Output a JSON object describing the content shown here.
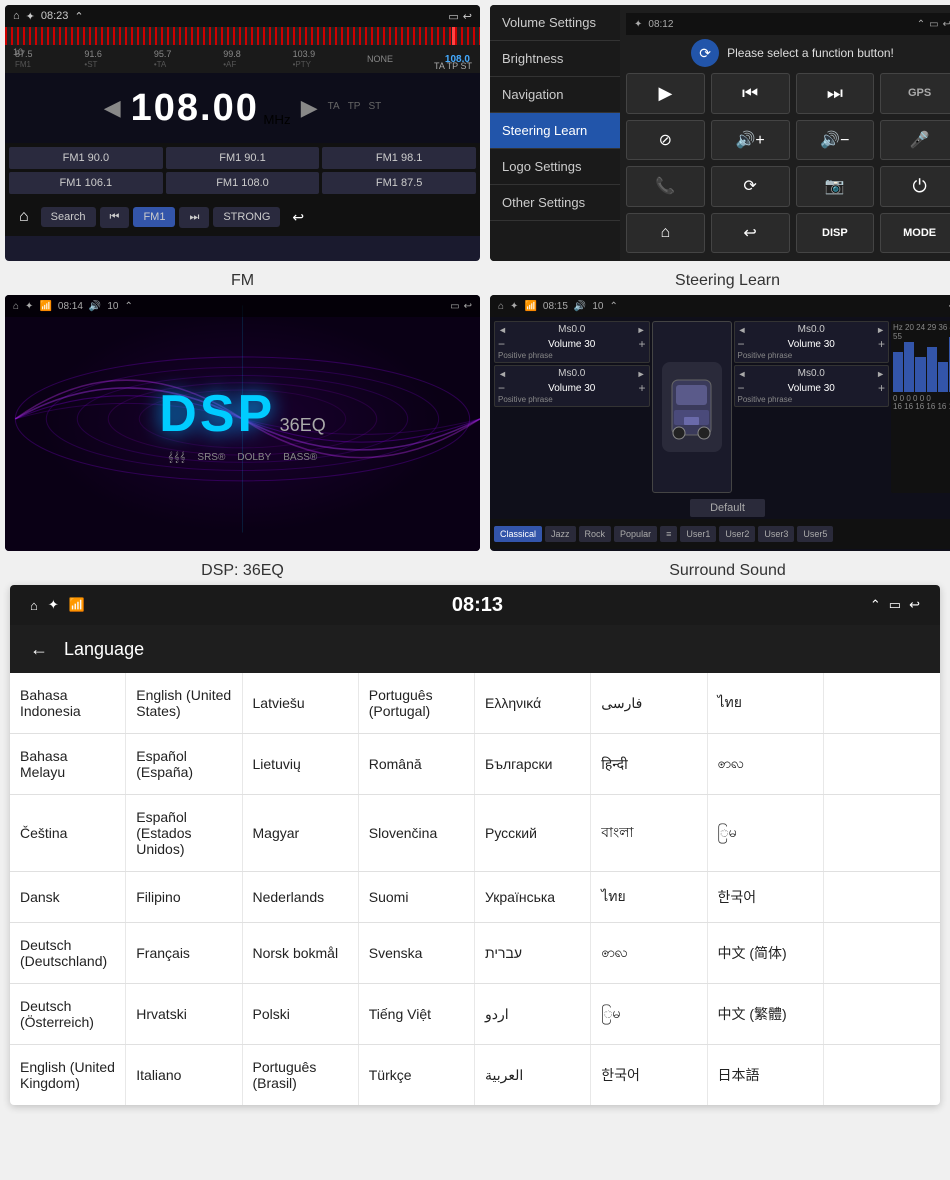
{
  "fm": {
    "caption": "FM",
    "status_bar": {
      "time": "08:23",
      "left_icons": [
        "home-icon",
        "bluetooth-icon",
        "signal-icon"
      ]
    },
    "frequency": "108.00",
    "unit": "MHz",
    "scale": {
      "values": [
        "87.5",
        "91.6",
        "95.7",
        "99.8",
        "103.9",
        "NONE",
        "108.0"
      ],
      "tags": [
        "FM1",
        "ST",
        "TA",
        "AF",
        "PTY",
        "",
        ""
      ],
      "bottom_tags": [
        "TA",
        "TP",
        "ST"
      ]
    },
    "presets": [
      "FM1 90.0",
      "FM1 90.1",
      "FM1 98.1",
      "FM1 106.1",
      "FM1 108.0",
      "FM1 87.5"
    ],
    "controls": [
      "🏠",
      "Search",
      "⏮",
      "FM1",
      "⏭",
      "STRONG",
      "↩"
    ]
  },
  "steering": {
    "caption": "Steering Learn",
    "status_bar_time": "08:12",
    "message": "Please select a function button!",
    "sidebar_items": [
      "Volume Settings",
      "Brightness",
      "Navigation",
      "Steering Learn",
      "Logo Settings",
      "Other Settings"
    ],
    "active_sidebar": "Steering Learn",
    "buttons": {
      "row1": [
        "▶",
        "⏮",
        "⏭",
        "GPS"
      ],
      "row2": [
        "⊘",
        "🔊+",
        "🔊-",
        "🎤"
      ],
      "row3": [
        "📞",
        "⟳",
        "📷",
        "⏻"
      ],
      "row4": [
        "🏠",
        "↩",
        "DISP",
        "MODE"
      ]
    },
    "gps_label": "GPS",
    "disp_label": "DISP",
    "mode_label": "MODE"
  },
  "dsp": {
    "caption": "DSP: 36EQ",
    "title": "DSP",
    "subtitle": "36EQ",
    "tags": [
      "𝄞𝄞𝄞",
      "SRS®",
      "DOLBY",
      "BASS®"
    ],
    "status_bar": {
      "time": "08:14",
      "volume": "10"
    }
  },
  "surround": {
    "caption": "Surround Sound",
    "status_bar": {
      "time": "08:15",
      "volume": "10"
    },
    "controls": [
      {
        "preset": "Ms0.0",
        "volume": "Volume 30",
        "phrase": "Positive phrase"
      },
      {
        "preset": "Ms0.0",
        "volume": "Volume 30",
        "phrase": "Positive phrase"
      },
      {
        "preset": "Ms0.0",
        "volume": "Volume 30",
        "phrase": "Positive phrase"
      },
      {
        "preset": "Ms0.0",
        "volume": "Volume 30",
        "phrase": "Positive phrase"
      }
    ],
    "default_btn": "Default",
    "tabs": [
      "Classical",
      "Jazz",
      "Rock",
      "Popular",
      "",
      "User1",
      "User2",
      "User3",
      "User5"
    ]
  },
  "language": {
    "status_bar": {
      "time": "08:13",
      "left": "⌂",
      "right_icons": [
        "signal-icon",
        "bluetooth-icon",
        "expand-icon",
        "window-icon",
        "back-icon"
      ]
    },
    "back_label": "←",
    "title": "Language",
    "rows": [
      [
        "Bahasa Indonesia",
        "English (United States)",
        "Latviešu",
        "Português (Portugal)",
        "Ελληνικά",
        "فارسی",
        "ไทย",
        ""
      ],
      [
        "Bahasa Melayu",
        "Español (España)",
        "Lietuvių",
        "Română",
        "Български",
        "हिन्दी",
        "ꩦꩮ",
        ""
      ],
      [
        "Čeština",
        "Español (Estados Unidos)",
        "Magyar",
        "Slovenčina",
        "Русский",
        "বাংলা",
        "ြမ",
        ""
      ],
      [
        "Dansk",
        "Filipino",
        "Nederlands",
        "Suomi",
        "Українська",
        "ไทย",
        "한국어",
        ""
      ],
      [
        "Deutsch (Deutschland)",
        "Français",
        "Norsk bokmål",
        "Svenska",
        "עברית",
        "ꩦꩮ",
        "中文 (简体)",
        ""
      ],
      [
        "Deutsch (Österreich)",
        "Hrvatski",
        "Polski",
        "Tiếng Việt",
        "اردو",
        "ြမ",
        "中文 (繁體)",
        ""
      ],
      [
        "English (United Kingdom)",
        "Italiano",
        "Português (Brasil)",
        "Türkçe",
        "العربية",
        "한국어",
        "日本語",
        ""
      ]
    ]
  }
}
